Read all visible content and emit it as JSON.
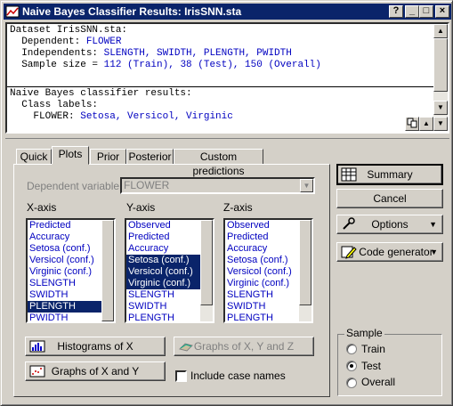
{
  "window": {
    "title": "Naive Bayes Classifier Results: IrisSNN.sta",
    "help_label": "?",
    "minimize_label": "_",
    "maximize_label": "□",
    "close_label": "×"
  },
  "output": {
    "lines": [
      {
        "label": "Dataset IrisSNN.sta:",
        "value": ""
      },
      {
        "label": "  Dependent: ",
        "value": "FLOWER"
      },
      {
        "label": "  Independents: ",
        "value": "SLENGTH, SWIDTH, PLENGTH, PWIDTH"
      },
      {
        "label": "  Sample size = ",
        "value": "112 (Train), 38 (Test), 150 (Overall)"
      },
      {
        "label": "",
        "value": ""
      },
      {
        "label": "Naive Bayes classifier results:",
        "value": ""
      },
      {
        "label": "  Class labels:",
        "value": ""
      },
      {
        "label": "    FLOWER: ",
        "value": "Setosa, Versicol, Virginic"
      }
    ]
  },
  "tabs": [
    "Quick",
    "Plots",
    "Prior",
    "Posterior",
    "Custom predictions"
  ],
  "active_tab": "Plots",
  "dependent_variable": {
    "label": "Dependent variable:",
    "value": "FLOWER"
  },
  "axes": {
    "x": {
      "label": "X-axis",
      "items": [
        "Predicted",
        "Accuracy",
        "Setosa (conf.)",
        "Versicol (conf.)",
        "Virginic (conf.)",
        "SLENGTH",
        "SWIDTH",
        "PLENGTH",
        "PWIDTH"
      ],
      "selected": [
        "PLENGTH"
      ]
    },
    "y": {
      "label": "Y-axis",
      "items": [
        "Observed",
        "Predicted",
        "Accuracy",
        "Setosa (conf.)",
        "Versicol (conf.)",
        "Virginic (conf.)",
        "SLENGTH",
        "SWIDTH",
        "PLENGTH"
      ],
      "selected": [
        "Setosa (conf.)",
        "Versicol (conf.)",
        "Virginic (conf.)"
      ]
    },
    "z": {
      "label": "Z-axis",
      "items": [
        "Observed",
        "Predicted",
        "Accuracy",
        "Setosa (conf.)",
        "Versicol (conf.)",
        "Virginic (conf.)",
        "SLENGTH",
        "SWIDTH",
        "PLENGTH"
      ],
      "selected": []
    }
  },
  "buttons": {
    "histograms": "Histograms of X",
    "graphs_xyz": "Graphs of X, Y and Z",
    "graphs_xy": "Graphs of X and Y",
    "include_case_names": "Include case names",
    "summary": "Summary",
    "cancel": "Cancel",
    "options": "Options",
    "code_generator": "Code generator"
  },
  "sample": {
    "label": "Sample",
    "options": [
      "Train",
      "Test",
      "Overall"
    ],
    "selected": "Test"
  }
}
